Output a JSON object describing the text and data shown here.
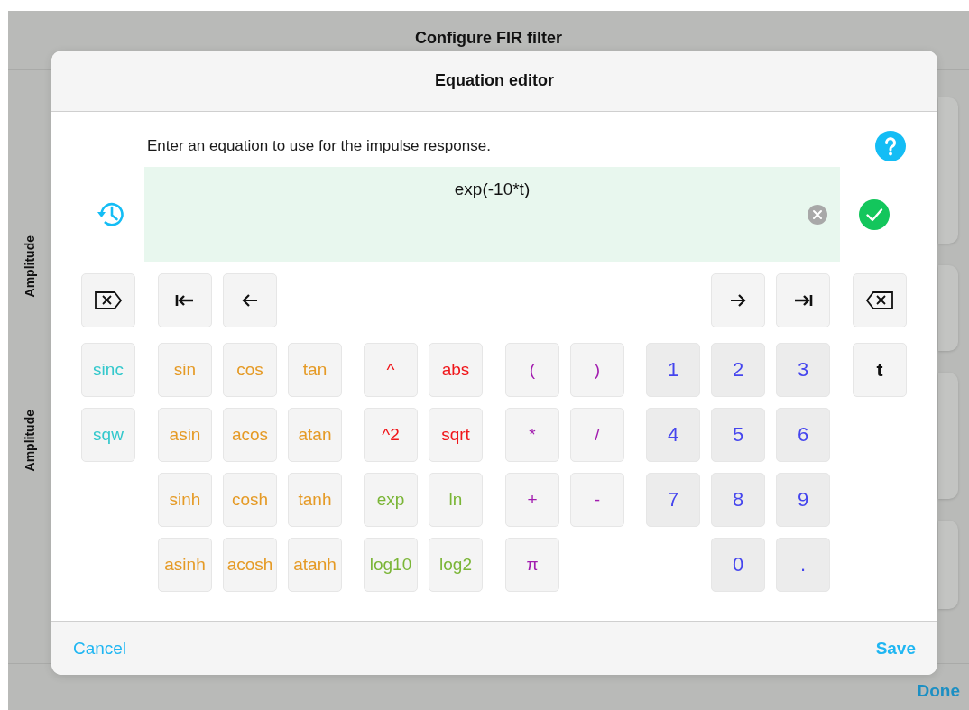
{
  "background": {
    "title": "Configure FIR filter",
    "axis_labels": [
      "Amplitude",
      "Amplitude"
    ],
    "done_button": "Done"
  },
  "dialog": {
    "title": "Equation editor",
    "instruction": "Enter an equation to use for the impulse response.",
    "equation": "exp(-10*t)",
    "keypad_rows": [
      [
        {
          "label": "sinc",
          "kind": "special"
        },
        {
          "label": "sin",
          "kind": "trig"
        },
        {
          "label": "cos",
          "kind": "trig"
        },
        {
          "label": "tan",
          "kind": "trig"
        },
        {
          "label": "^",
          "kind": "power"
        },
        {
          "label": "abs",
          "kind": "power"
        },
        {
          "label": "(",
          "kind": "operator"
        },
        {
          "label": ")",
          "kind": "operator"
        },
        {
          "label": "1",
          "kind": "digit"
        },
        {
          "label": "2",
          "kind": "digit"
        },
        {
          "label": "3",
          "kind": "digit"
        },
        {
          "label": "t",
          "kind": "variable"
        }
      ],
      [
        {
          "label": "sqw",
          "kind": "special"
        },
        {
          "label": "asin",
          "kind": "trig"
        },
        {
          "label": "acos",
          "kind": "trig"
        },
        {
          "label": "atan",
          "kind": "trig"
        },
        {
          "label": "^2",
          "kind": "power"
        },
        {
          "label": "sqrt",
          "kind": "power"
        },
        {
          "label": "*",
          "kind": "operator"
        },
        {
          "label": "/",
          "kind": "operator"
        },
        {
          "label": "4",
          "kind": "digit"
        },
        {
          "label": "5",
          "kind": "digit"
        },
        {
          "label": "6",
          "kind": "digit"
        }
      ],
      [
        {
          "label": "sinh",
          "kind": "trig"
        },
        {
          "label": "cosh",
          "kind": "trig"
        },
        {
          "label": "tanh",
          "kind": "trig"
        },
        {
          "label": "exp",
          "kind": "log"
        },
        {
          "label": "ln",
          "kind": "log"
        },
        {
          "label": "+",
          "kind": "operator"
        },
        {
          "label": "-",
          "kind": "operator"
        },
        {
          "label": "7",
          "kind": "digit"
        },
        {
          "label": "8",
          "kind": "digit"
        },
        {
          "label": "9",
          "kind": "digit"
        }
      ],
      [
        {
          "label": "asinh",
          "kind": "trig"
        },
        {
          "label": "acosh",
          "kind": "trig"
        },
        {
          "label": "atanh",
          "kind": "trig"
        },
        {
          "label": "log10",
          "kind": "log"
        },
        {
          "label": "log2",
          "kind": "log"
        },
        {
          "label": "π",
          "kind": "operator"
        },
        {
          "label": "0",
          "kind": "digit"
        },
        {
          "label": ".",
          "kind": "digit"
        }
      ]
    ],
    "cancel_button": "Cancel",
    "save_button": "Save"
  }
}
